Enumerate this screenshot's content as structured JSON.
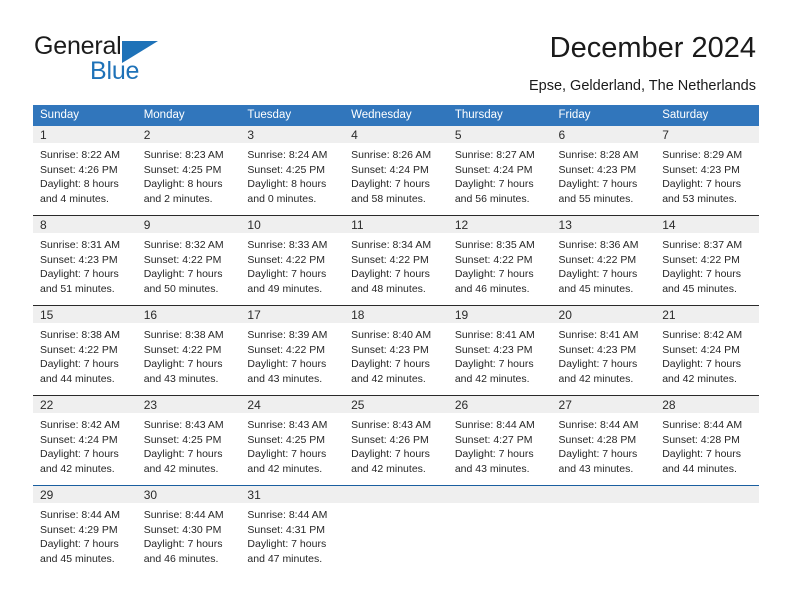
{
  "brand": {
    "name_part1": "General",
    "name_part2": "Blue",
    "accent_color": "#1e72b8"
  },
  "header": {
    "title": "December 2024",
    "subtitle": "Epse, Gelderland, The Netherlands"
  },
  "calendar": {
    "header_bg": "#3176bc",
    "daynum_bg": "#efefef",
    "weekday_headers": [
      "Sunday",
      "Monday",
      "Tuesday",
      "Wednesday",
      "Thursday",
      "Friday",
      "Saturday"
    ],
    "weeks": [
      [
        {
          "day": "1",
          "sunrise": "Sunrise: 8:22 AM",
          "sunset": "Sunset: 4:26 PM",
          "daylight_line1": "Daylight: 8 hours",
          "daylight_line2": "and 4 minutes."
        },
        {
          "day": "2",
          "sunrise": "Sunrise: 8:23 AM",
          "sunset": "Sunset: 4:25 PM",
          "daylight_line1": "Daylight: 8 hours",
          "daylight_line2": "and 2 minutes."
        },
        {
          "day": "3",
          "sunrise": "Sunrise: 8:24 AM",
          "sunset": "Sunset: 4:25 PM",
          "daylight_line1": "Daylight: 8 hours",
          "daylight_line2": "and 0 minutes."
        },
        {
          "day": "4",
          "sunrise": "Sunrise: 8:26 AM",
          "sunset": "Sunset: 4:24 PM",
          "daylight_line1": "Daylight: 7 hours",
          "daylight_line2": "and 58 minutes."
        },
        {
          "day": "5",
          "sunrise": "Sunrise: 8:27 AM",
          "sunset": "Sunset: 4:24 PM",
          "daylight_line1": "Daylight: 7 hours",
          "daylight_line2": "and 56 minutes."
        },
        {
          "day": "6",
          "sunrise": "Sunrise: 8:28 AM",
          "sunset": "Sunset: 4:23 PM",
          "daylight_line1": "Daylight: 7 hours",
          "daylight_line2": "and 55 minutes."
        },
        {
          "day": "7",
          "sunrise": "Sunrise: 8:29 AM",
          "sunset": "Sunset: 4:23 PM",
          "daylight_line1": "Daylight: 7 hours",
          "daylight_line2": "and 53 minutes."
        }
      ],
      [
        {
          "day": "8",
          "sunrise": "Sunrise: 8:31 AM",
          "sunset": "Sunset: 4:23 PM",
          "daylight_line1": "Daylight: 7 hours",
          "daylight_line2": "and 51 minutes."
        },
        {
          "day": "9",
          "sunrise": "Sunrise: 8:32 AM",
          "sunset": "Sunset: 4:22 PM",
          "daylight_line1": "Daylight: 7 hours",
          "daylight_line2": "and 50 minutes."
        },
        {
          "day": "10",
          "sunrise": "Sunrise: 8:33 AM",
          "sunset": "Sunset: 4:22 PM",
          "daylight_line1": "Daylight: 7 hours",
          "daylight_line2": "and 49 minutes."
        },
        {
          "day": "11",
          "sunrise": "Sunrise: 8:34 AM",
          "sunset": "Sunset: 4:22 PM",
          "daylight_line1": "Daylight: 7 hours",
          "daylight_line2": "and 48 minutes."
        },
        {
          "day": "12",
          "sunrise": "Sunrise: 8:35 AM",
          "sunset": "Sunset: 4:22 PM",
          "daylight_line1": "Daylight: 7 hours",
          "daylight_line2": "and 46 minutes."
        },
        {
          "day": "13",
          "sunrise": "Sunrise: 8:36 AM",
          "sunset": "Sunset: 4:22 PM",
          "daylight_line1": "Daylight: 7 hours",
          "daylight_line2": "and 45 minutes."
        },
        {
          "day": "14",
          "sunrise": "Sunrise: 8:37 AM",
          "sunset": "Sunset: 4:22 PM",
          "daylight_line1": "Daylight: 7 hours",
          "daylight_line2": "and 45 minutes."
        }
      ],
      [
        {
          "day": "15",
          "sunrise": "Sunrise: 8:38 AM",
          "sunset": "Sunset: 4:22 PM",
          "daylight_line1": "Daylight: 7 hours",
          "daylight_line2": "and 44 minutes."
        },
        {
          "day": "16",
          "sunrise": "Sunrise: 8:38 AM",
          "sunset": "Sunset: 4:22 PM",
          "daylight_line1": "Daylight: 7 hours",
          "daylight_line2": "and 43 minutes."
        },
        {
          "day": "17",
          "sunrise": "Sunrise: 8:39 AM",
          "sunset": "Sunset: 4:22 PM",
          "daylight_line1": "Daylight: 7 hours",
          "daylight_line2": "and 43 minutes."
        },
        {
          "day": "18",
          "sunrise": "Sunrise: 8:40 AM",
          "sunset": "Sunset: 4:23 PM",
          "daylight_line1": "Daylight: 7 hours",
          "daylight_line2": "and 42 minutes."
        },
        {
          "day": "19",
          "sunrise": "Sunrise: 8:41 AM",
          "sunset": "Sunset: 4:23 PM",
          "daylight_line1": "Daylight: 7 hours",
          "daylight_line2": "and 42 minutes."
        },
        {
          "day": "20",
          "sunrise": "Sunrise: 8:41 AM",
          "sunset": "Sunset: 4:23 PM",
          "daylight_line1": "Daylight: 7 hours",
          "daylight_line2": "and 42 minutes."
        },
        {
          "day": "21",
          "sunrise": "Sunrise: 8:42 AM",
          "sunset": "Sunset: 4:24 PM",
          "daylight_line1": "Daylight: 7 hours",
          "daylight_line2": "and 42 minutes."
        }
      ],
      [
        {
          "day": "22",
          "sunrise": "Sunrise: 8:42 AM",
          "sunset": "Sunset: 4:24 PM",
          "daylight_line1": "Daylight: 7 hours",
          "daylight_line2": "and 42 minutes."
        },
        {
          "day": "23",
          "sunrise": "Sunrise: 8:43 AM",
          "sunset": "Sunset: 4:25 PM",
          "daylight_line1": "Daylight: 7 hours",
          "daylight_line2": "and 42 minutes."
        },
        {
          "day": "24",
          "sunrise": "Sunrise: 8:43 AM",
          "sunset": "Sunset: 4:25 PM",
          "daylight_line1": "Daylight: 7 hours",
          "daylight_line2": "and 42 minutes."
        },
        {
          "day": "25",
          "sunrise": "Sunrise: 8:43 AM",
          "sunset": "Sunset: 4:26 PM",
          "daylight_line1": "Daylight: 7 hours",
          "daylight_line2": "and 42 minutes."
        },
        {
          "day": "26",
          "sunrise": "Sunrise: 8:44 AM",
          "sunset": "Sunset: 4:27 PM",
          "daylight_line1": "Daylight: 7 hours",
          "daylight_line2": "and 43 minutes."
        },
        {
          "day": "27",
          "sunrise": "Sunrise: 8:44 AM",
          "sunset": "Sunset: 4:28 PM",
          "daylight_line1": "Daylight: 7 hours",
          "daylight_line2": "and 43 minutes."
        },
        {
          "day": "28",
          "sunrise": "Sunrise: 8:44 AM",
          "sunset": "Sunset: 4:28 PM",
          "daylight_line1": "Daylight: 7 hours",
          "daylight_line2": "and 44 minutes."
        }
      ],
      [
        {
          "day": "29",
          "sunrise": "Sunrise: 8:44 AM",
          "sunset": "Sunset: 4:29 PM",
          "daylight_line1": "Daylight: 7 hours",
          "daylight_line2": "and 45 minutes."
        },
        {
          "day": "30",
          "sunrise": "Sunrise: 8:44 AM",
          "sunset": "Sunset: 4:30 PM",
          "daylight_line1": "Daylight: 7 hours",
          "daylight_line2": "and 46 minutes."
        },
        {
          "day": "31",
          "sunrise": "Sunrise: 8:44 AM",
          "sunset": "Sunset: 4:31 PM",
          "daylight_line1": "Daylight: 7 hours",
          "daylight_line2": "and 47 minutes."
        },
        {
          "day": "",
          "sunrise": "",
          "sunset": "",
          "daylight_line1": "",
          "daylight_line2": ""
        },
        {
          "day": "",
          "sunrise": "",
          "sunset": "",
          "daylight_line1": "",
          "daylight_line2": ""
        },
        {
          "day": "",
          "sunrise": "",
          "sunset": "",
          "daylight_line1": "",
          "daylight_line2": ""
        },
        {
          "day": "",
          "sunrise": "",
          "sunset": "",
          "daylight_line1": "",
          "daylight_line2": ""
        }
      ]
    ]
  }
}
